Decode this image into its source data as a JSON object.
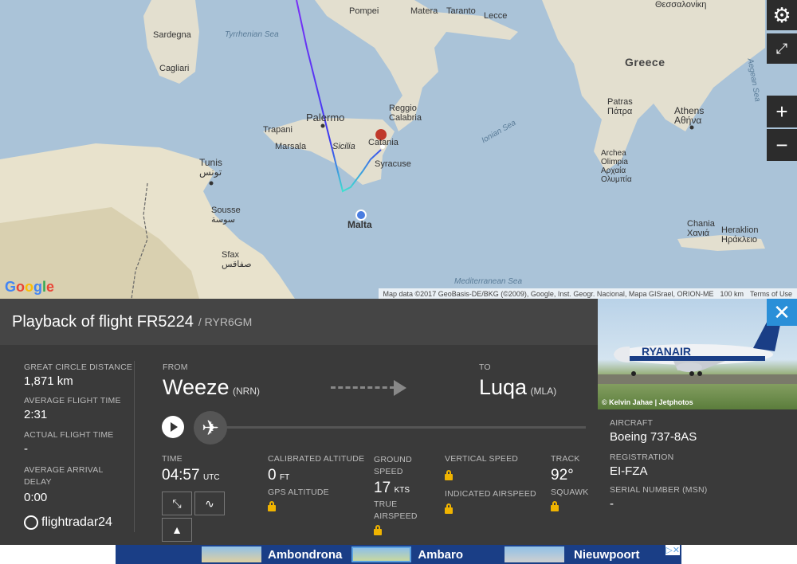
{
  "map": {
    "labels": {
      "pompei": "Pompei",
      "matera": "Matera",
      "taranto": "Taranto",
      "lecce": "Lecce",
      "thessaloniki": "Θεσσαλονίκη",
      "sardegna": "Sardegna",
      "tyrrhenian": "Tyrrhenian Sea",
      "greece": "Greece",
      "cagliari": "Cagliari",
      "aegean": "Aegean Sea",
      "reggio": "Reggio\nCalabria",
      "palermo": "Palermo",
      "trapani": "Trapani",
      "patras": "Patras\nΠάτρα",
      "athens": "Athens\nΑθήνα",
      "ionian": "Ionian Sea",
      "marsala": "Marsala",
      "sicilia": "Sicilia",
      "catania": "Catania",
      "tunis": "Tunis\nتونس",
      "syracuse": "Syracuse",
      "archea": "Archea\nOlimpia\nΑρχαία\nΟλυμπία",
      "sousse": "Sousse\nسوسة",
      "malta": "Malta",
      "chania": "Chania\nΧανιά",
      "heraklion": "Heraklion\nΗράκλειο",
      "sfax": "Sfax\nصفاقس",
      "mediterranean": "Mediterranean Sea"
    },
    "attribution": "Map data ©2017 GeoBasis-DE/BKG (©2009), Google, Inst. Geogr. Nacional, Mapa GISrael, ORION-ME",
    "scale": "100 km",
    "terms": "Terms of Use",
    "google": "Google",
    "controls": {
      "settings_icon": "gear-icon",
      "fullscreen_icon": "expand-icon",
      "zoom_in": "+",
      "zoom_out": "−"
    },
    "colors": {
      "sea": "#aac3d8",
      "land": "#e3dfcf",
      "track_start": "#7b2ff7",
      "track_end": "#40e0d0"
    }
  },
  "panel": {
    "title": "Playback of flight FR5224",
    "callsign": "/ RYR6GM",
    "great_circle_label": "GREAT CIRCLE DISTANCE",
    "great_circle_value": "1,871 km",
    "avg_flight_label": "AVERAGE FLIGHT TIME",
    "avg_flight_value": "2:31",
    "actual_flight_label": "ACTUAL FLIGHT TIME",
    "actual_flight_value": "-",
    "avg_arrival_label": "AVERAGE ARRIVAL DELAY",
    "avg_arrival_value": "0:00",
    "brand": "flightradar24",
    "from_label": "FROM",
    "from_city": "Weeze",
    "from_code": "(NRN)",
    "to_label": "TO",
    "to_city": "Luqa",
    "to_code": "(MLA)",
    "time_label": "TIME",
    "time_value": "04:57",
    "time_unit": "UTC",
    "cal_alt_label": "CALIBRATED ALTITUDE",
    "cal_alt_value": "0",
    "cal_alt_unit": "FT",
    "gps_alt_label": "GPS ALTITUDE",
    "ground_speed_label": "GROUND SPEED",
    "ground_speed_value": "17",
    "ground_speed_unit": "KTS",
    "true_airspeed_label": "TRUE AIRSPEED",
    "vertical_speed_label": "VERTICAL SPEED",
    "indicated_airspeed_label": "INDICATED AIRSPEED",
    "track_label": "TRACK",
    "track_value": "92°",
    "squawk_label": "SQUAWK"
  },
  "aircraft": {
    "photo_credit": "© Kelvin Jahae | Jetphotos",
    "airline_text": "RYANAIR",
    "aircraft_label": "AIRCRAFT",
    "aircraft_value": "Boeing 737-8AS",
    "registration_label": "REGISTRATION",
    "registration_value": "EI-FZA",
    "serial_label": "SERIAL NUMBER (MSN)",
    "serial_value": "-"
  },
  "ad": {
    "tile1": "Ambondrona",
    "tile2": "Ambaro",
    "tile3": "Nieuwpoort"
  }
}
